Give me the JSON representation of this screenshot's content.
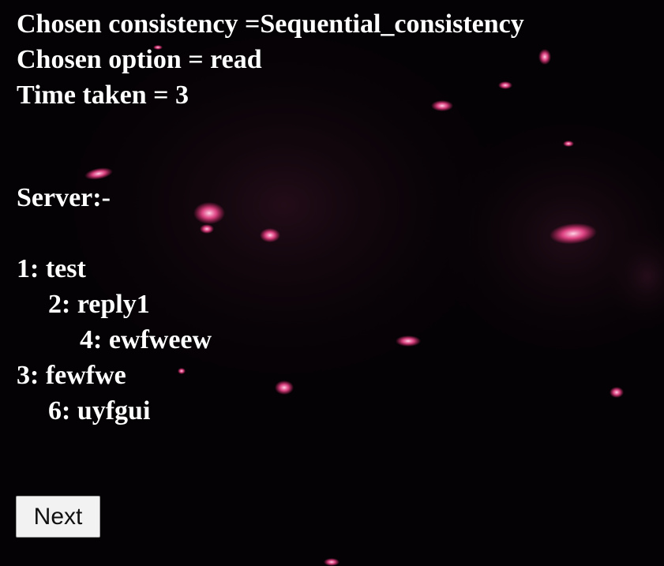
{
  "status": {
    "consistency_line": "Chosen consistency =Sequential_consistency",
    "option_line": "Chosen option = read",
    "time_line": "Time taken = 3"
  },
  "server": {
    "heading": "Server:-",
    "items": [
      {
        "text": "1: test",
        "level": 0
      },
      {
        "text": "2: reply1",
        "level": 1
      },
      {
        "text": "4: ewfweew",
        "level": 2
      },
      {
        "text": "3: fewfwe",
        "level": 0
      },
      {
        "text": "6: uyfgui",
        "level": 1
      }
    ]
  },
  "actions": {
    "next_label": "Next"
  },
  "colors": {
    "background": "#050205",
    "text": "#ffffff",
    "accent_particles": "#ff6fa8"
  }
}
